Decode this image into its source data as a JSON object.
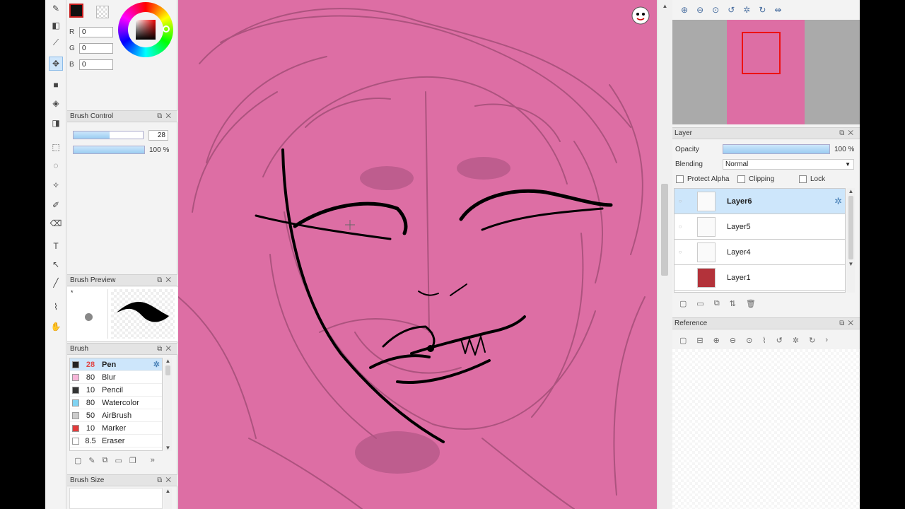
{
  "color": {
    "r_label": "R",
    "r_value": "0",
    "g_label": "G",
    "g_value": "0",
    "b_label": "B",
    "b_value": "0",
    "foreground": "#111111",
    "accent": "#c81d1d"
  },
  "brush_control": {
    "title": "Brush Control",
    "size_value": "28",
    "size_fill": 0.52,
    "opacity_label": "100 %",
    "opacity_fill": 1.0
  },
  "brush_preview": {
    "title": "Brush Preview",
    "marker": "*"
  },
  "brush": {
    "title": "Brush",
    "items": [
      {
        "size": "28",
        "name": "Pen",
        "color": "#222222"
      },
      {
        "size": "80",
        "name": "Blur",
        "color": "#f7b6d9"
      },
      {
        "size": "10",
        "name": "Pencil",
        "color": "#333333"
      },
      {
        "size": "80",
        "name": "Watercolor",
        "color": "#7fd3f2"
      },
      {
        "size": "50",
        "name": "AirBrush",
        "color": "#cccccc"
      },
      {
        "size": "10",
        "name": "Marker",
        "color": "#e33b3b"
      },
      {
        "size": "8.5",
        "name": "Eraser",
        "color": "#ffffff"
      }
    ]
  },
  "brush_size": {
    "title": "Brush Size"
  },
  "layer": {
    "title": "Layer",
    "opacity_label": "Opacity",
    "opacity_value": "100 %",
    "opacity_fill": 1.0,
    "blending_label": "Blending",
    "blending_value": "Normal",
    "protect_alpha": "Protect Alpha",
    "clipping": "Clipping",
    "lock": "Lock",
    "layers": [
      {
        "name": "Layer6"
      },
      {
        "name": "Layer5"
      },
      {
        "name": "Layer4"
      },
      {
        "name": "Layer1"
      }
    ]
  },
  "reference": {
    "title": "Reference"
  },
  "canvas": {
    "background": "#dd6ea4"
  }
}
